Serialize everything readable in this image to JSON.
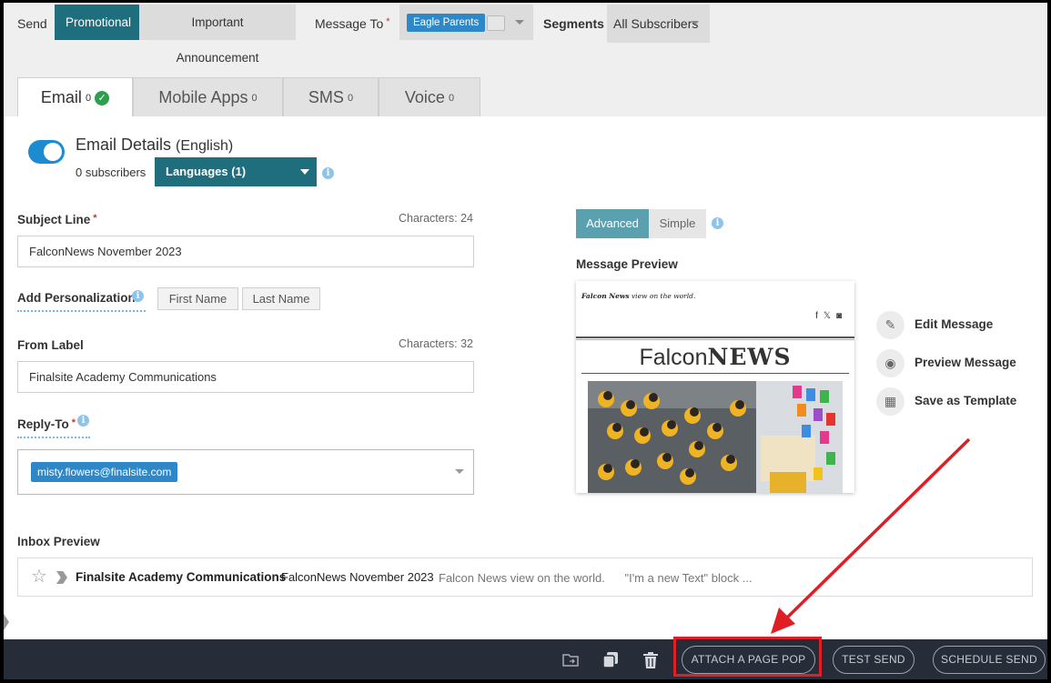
{
  "top_bar": {
    "send_label": "Send",
    "send_types": [
      "Promotional",
      "Important Announcement"
    ],
    "message_to_label": "Message To",
    "required_mark": "*",
    "recipient_chip": "Eagle Parents",
    "segments_label": "Segments",
    "segments_value": "All Subscribers"
  },
  "tabs": [
    {
      "label": "Email",
      "count": "0"
    },
    {
      "label": "Mobile Apps",
      "count": "0"
    },
    {
      "label": "SMS",
      "count": "0"
    },
    {
      "label": "Voice",
      "count": "0"
    }
  ],
  "email_details": {
    "title": "Email Details",
    "language_paren": "(English)",
    "subscribers": "0 subscribers",
    "languages_button": "Languages (1)"
  },
  "form": {
    "subject_label": "Subject Line",
    "subject_chars": "Characters: 24",
    "subject_value": "FalconNews November 2023",
    "personalization_label": "Add Personalization",
    "personalization_buttons": [
      "First Name",
      "Last Name"
    ],
    "from_label": "From Label",
    "from_chars": "Characters: 32",
    "from_value": "Finalsite Academy Communications",
    "reply_to_label": "Reply-To",
    "reply_to_chip": "misty.flowers@finalsite.com"
  },
  "editor_mode": {
    "options": [
      "Advanced",
      "Simple"
    ],
    "selected": "Advanced"
  },
  "message_preview": {
    "label": "Message Preview",
    "tagline_bold": "Falcon News",
    "tagline_rest": " view on the world.",
    "masthead_light": "Falcon",
    "masthead_bold": "NEWS",
    "social_icons": [
      "facebook-icon",
      "x-icon",
      "instagram-icon"
    ]
  },
  "actions": [
    "Edit Message",
    "Preview Message",
    "Save as Template"
  ],
  "inbox_preview": {
    "label": "Inbox Preview",
    "from": "Finalsite Academy Communications",
    "subject": "FalconNews November 2023",
    "snippet": "Falcon News view on the world.      \"I'm a new Text\" block ..."
  },
  "bottom_bar": {
    "buttons": [
      "ATTACH A PAGE POP",
      "TEST SEND",
      "SCHEDULE SEND"
    ],
    "icons": [
      "move-to-folder-icon",
      "copy-icon",
      "trash-icon"
    ]
  },
  "colors": {
    "primary": "#1f6e7e",
    "chip_blue": "#2e87c6",
    "toggle_on": "#1d8bd0",
    "bottom_bar": "#262d38",
    "annotation_red": "#e01e25"
  }
}
